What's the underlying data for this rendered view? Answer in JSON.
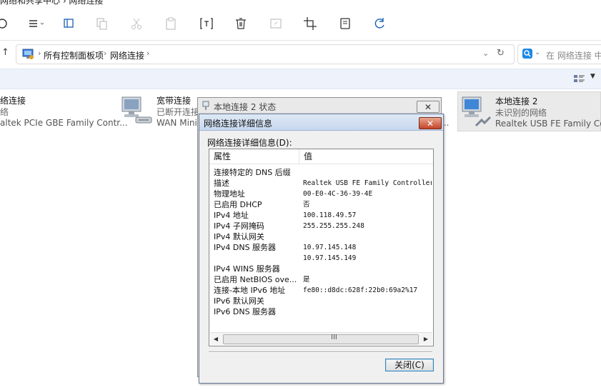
{
  "explorer": {
    "window_title_fragment": "网络和共享中心 › 网络连接",
    "breadcrumb": [
      "所有控制面板项",
      "网络连接"
    ],
    "search_placeholder": "在 网络连接 中搜索",
    "connections": [
      {
        "name": "以太网连接",
        "status": "网络",
        "adapter": "Realtek PCIe GBE Family Controller"
      },
      {
        "name": "宽带连接",
        "status": "已断开连接",
        "adapter": "WAN Miniport (PPPOE)"
      },
      {
        "name": "本地连接 2",
        "status": "未识别的网络",
        "adapter": "Realtek USB FE Family Controller"
      }
    ],
    "visible_text": {
      "conn0_name": "络连接",
      "conn0_status": "络",
      "conn0_adapter": "altek PCIe GBE Family Contr...",
      "conn1_name": "宽带连接",
      "conn1_status": "已断开连接",
      "conn1_adapter": "WAN Mini",
      "conn2_name": "本地连接 2",
      "conn2_status": "未识别的网络",
      "conn2_adapter": "Realtek USB FE Family Cont",
      "hidden_ellipsis": "..."
    }
  },
  "status_window": {
    "title": "本地连接 2 状态",
    "close_glyph": "✕"
  },
  "details_dialog": {
    "title": "网络连接详细信息",
    "close_glyph": "✕",
    "list_label": "网络连接详细信息(D):",
    "columns": {
      "property": "属性",
      "value": "值"
    },
    "rows": [
      {
        "property": "连接特定的 DNS 后缀",
        "value": ""
      },
      {
        "property": "描述",
        "value": "Realtek USB FE Family Controller"
      },
      {
        "property": "物理地址",
        "value": "00-E0-4C-36-39-4E"
      },
      {
        "property": "已启用 DHCP",
        "value": "否"
      },
      {
        "property": "IPv4 地址",
        "value": "100.118.49.57"
      },
      {
        "property": "IPv4 子网掩码",
        "value": "255.255.255.248"
      },
      {
        "property": "IPv4 默认网关",
        "value": ""
      },
      {
        "property": "IPv4 DNS 服务器",
        "value": "10.97.145.148"
      },
      {
        "property": "",
        "value": "10.97.145.149"
      },
      {
        "property": "IPv4 WINS 服务器",
        "value": ""
      },
      {
        "property": "已启用 NetBIOS ove...",
        "value": "是"
      },
      {
        "property": "连接-本地 IPv6 地址",
        "value": "fe80::d8dc:628f:22b0:69a2%17"
      },
      {
        "property": "IPv6 默认网关",
        "value": ""
      },
      {
        "property": "IPv6 DNS 服务器",
        "value": ""
      }
    ],
    "scrollbar": {
      "left_arrow": "◀",
      "right_arrow": "▶",
      "grip": "III"
    },
    "close_button_label": "关闭(C)"
  },
  "colors": {
    "dialog_face": "#f0f0f0",
    "titlebar_active": "#c7d8ee",
    "close_red": "#c4442a",
    "command_bar": "#eef3fb"
  },
  "icons": [
    "back-icon",
    "menu-icon",
    "pane-icon",
    "copy-icon",
    "cut-icon",
    "paste-icon",
    "rename-icon",
    "delete-icon",
    "share-icon",
    "crop-icon",
    "properties-icon",
    "refresh-icon",
    "control-panel-icon",
    "network-adapter-icon",
    "view-options-icon",
    "search-icon"
  ]
}
